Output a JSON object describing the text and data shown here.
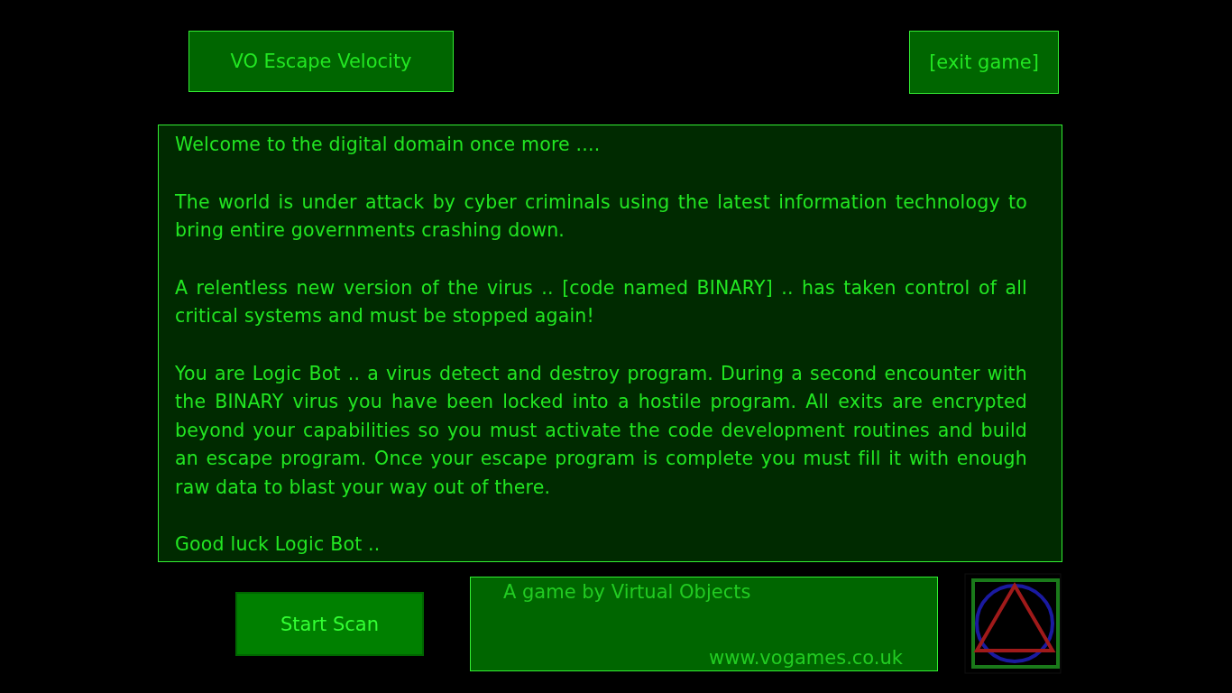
{
  "header": {
    "title": "VO Escape Velocity",
    "exit_button": "[exit game]"
  },
  "story": {
    "paragraphs": [
      "Welcome to the digital domain once more ....",
      "The world is under attack by cyber criminals using the latest information technology to bring entire governments crashing down.",
      "A relentless new version of the virus .. [code named BINARY] .. has taken control of all critical systems and must be stopped again!",
      "You are Logic Bot .. a virus detect and destroy program. During a second encounter with the BINARY virus you have been locked into a hostile program. All exits are encrypted beyond your capabilities so you must activate the code development routines and build an escape program. Once your escape program is complete you must fill it with enough raw data to blast your way out of there.",
      "Good luck Logic Bot .."
    ]
  },
  "footer": {
    "start_button": "Start Scan",
    "credit": "A game by Virtual Objects",
    "website": "www.vogames.co.uk"
  }
}
